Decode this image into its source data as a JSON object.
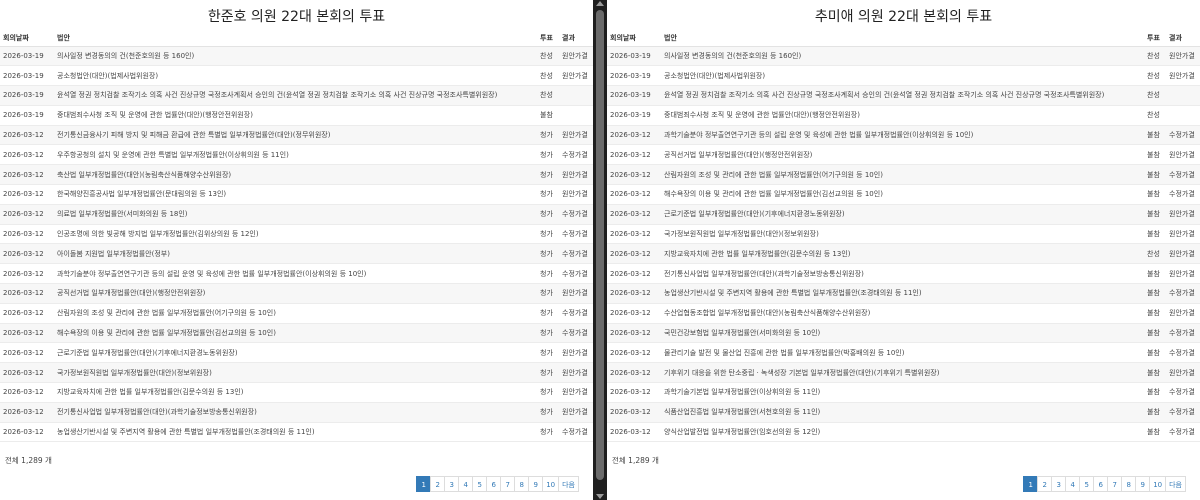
{
  "headers": {
    "date": "회의날짜",
    "bill": "법안",
    "vote": "투표",
    "result": "결과"
  },
  "left": {
    "title": "한준호 의원 22대 본회의 투표",
    "total": "전체 1,289 개",
    "rows": [
      {
        "date": "2026-03-19",
        "bill": "의사일정 변경동의의 건(천준호의원 등 160인)",
        "vote": "찬성",
        "result": "원안가결"
      },
      {
        "date": "2026-03-19",
        "bill": "공소청법안(대안)(법제사법위원장)",
        "vote": "찬성",
        "result": "원안가결"
      },
      {
        "date": "2026-03-19",
        "bill": "윤석열 정권 정치검찰 조작기소 의혹 사건 진상규명 국정조사계획서 승인의 건(윤석열 정권 정치검찰 조작기소 의혹 사건 진상규명 국정조사특별위원장)",
        "vote": "찬성",
        "result": ""
      },
      {
        "date": "2026-03-19",
        "bill": "중대범죄수사청 조직 및 운영에 관한 법률안(대안)(행정안전위원장)",
        "vote": "불참",
        "result": ""
      },
      {
        "date": "2026-03-12",
        "bill": "전기통신금융사기 피해 방지 및 피해금 환급에 관한 특별법 일부개정법률안(대안)(정무위원장)",
        "vote": "청가",
        "result": "원안가결"
      },
      {
        "date": "2026-03-12",
        "bill": "우주항공청의 설치 및 운영에 관한 특별법 일부개정법률안(이상휘의원 등 11인)",
        "vote": "청가",
        "result": "수정가결"
      },
      {
        "date": "2026-03-12",
        "bill": "축산법 일부개정법률안(대안)(농림축산식품해양수산위원장)",
        "vote": "청가",
        "result": "원안가결"
      },
      {
        "date": "2026-03-12",
        "bill": "한국해양진흥공사법 일부개정법률안(문대림의원 등 13인)",
        "vote": "청가",
        "result": "원안가결"
      },
      {
        "date": "2026-03-12",
        "bill": "의료법 일부개정법률안(서미화의원 등 18인)",
        "vote": "청가",
        "result": "수정가결"
      },
      {
        "date": "2026-03-12",
        "bill": "인공조명에 의한 빛공해 방지법 일부개정법률안(김위상의원 등 12인)",
        "vote": "청가",
        "result": "수정가결"
      },
      {
        "date": "2026-03-12",
        "bill": "아이돌봄 지원법 일부개정법률안(정부)",
        "vote": "청가",
        "result": "수정가결"
      },
      {
        "date": "2026-03-12",
        "bill": "과학기술분야 정부출연연구기관 등의 설립 운영 및 육성에 관한 법률 일부개정법률안(이상휘의원 등 10인)",
        "vote": "청가",
        "result": "수정가결"
      },
      {
        "date": "2026-03-12",
        "bill": "공직선거법 일부개정법률안(대안)(행정안전위원장)",
        "vote": "청가",
        "result": "원안가결"
      },
      {
        "date": "2026-03-12",
        "bill": "산림자원의 조성 및 관리에 관한 법률 일부개정법률안(어기구의원 등 10인)",
        "vote": "청가",
        "result": "수정가결"
      },
      {
        "date": "2026-03-12",
        "bill": "해수욕장의 이용 및 관리에 관한 법률 일부개정법률안(김선교의원 등 10인)",
        "vote": "청가",
        "result": "수정가결"
      },
      {
        "date": "2026-03-12",
        "bill": "근로기준법 일부개정법률안(대안)(기후에너지환경노동위원장)",
        "vote": "청가",
        "result": "원안가결"
      },
      {
        "date": "2026-03-12",
        "bill": "국가정보원직원법 일부개정법률안(대안)(정보위원장)",
        "vote": "청가",
        "result": "원안가결"
      },
      {
        "date": "2026-03-12",
        "bill": "지방교육자치에 관한 법률 일부개정법률안(김문수의원 등 13인)",
        "vote": "청가",
        "result": "원안가결"
      },
      {
        "date": "2026-03-12",
        "bill": "전기통신사업법 일부개정법률안(대안)(과학기술정보방송통신위원장)",
        "vote": "청가",
        "result": "원안가결"
      },
      {
        "date": "2026-03-12",
        "bill": "농업생산기반시설 및 주변지역 활용에 관한 특별법 일부개정법률안(조경태의원 등 11인)",
        "vote": "청가",
        "result": "수정가결"
      }
    ]
  },
  "right": {
    "title": "추미애 의원 22대 본회의 투표",
    "total": "전체 1,289 개",
    "rows": [
      {
        "date": "2026-03-19",
        "bill": "의사일정 변경동의의 건(천준호의원 등 160인)",
        "vote": "찬성",
        "result": "원안가결"
      },
      {
        "date": "2026-03-19",
        "bill": "공소청법안(대안)(법제사법위원장)",
        "vote": "찬성",
        "result": "원안가결"
      },
      {
        "date": "2026-03-19",
        "bill": "윤석열 정권 정치검찰 조작기소 의혹 사건 진상규명 국정조사계획서 승인의 건(윤석열 정권 정치검찰 조작기소 의혹 사건 진상규명 국정조사특별위원장)",
        "vote": "찬성",
        "result": ""
      },
      {
        "date": "2026-03-19",
        "bill": "중대범죄수사청 조직 및 운영에 관한 법률안(대안)(행정안전위원장)",
        "vote": "찬성",
        "result": ""
      },
      {
        "date": "2026-03-12",
        "bill": "과학기술분야 정부출연연구기관 등의 설립 운영 및 육성에 관한 법률 일부개정법률안(이상휘의원 등 10인)",
        "vote": "불참",
        "result": "수정가결"
      },
      {
        "date": "2026-03-12",
        "bill": "공직선거법 일부개정법률안(대안)(행정안전위원장)",
        "vote": "불참",
        "result": "원안가결"
      },
      {
        "date": "2026-03-12",
        "bill": "산림자원의 조성 및 관리에 관한 법률 일부개정법률안(어기구의원 등 10인)",
        "vote": "불참",
        "result": "수정가결"
      },
      {
        "date": "2026-03-12",
        "bill": "해수욕장의 이용 및 관리에 관한 법률 일부개정법률안(김선교의원 등 10인)",
        "vote": "불참",
        "result": "수정가결"
      },
      {
        "date": "2026-03-12",
        "bill": "근로기준법 일부개정법률안(대안)(기후에너지환경노동위원장)",
        "vote": "불참",
        "result": "원안가결"
      },
      {
        "date": "2026-03-12",
        "bill": "국가정보원직원법 일부개정법률안(대안)(정보위원장)",
        "vote": "불참",
        "result": "원안가결"
      },
      {
        "date": "2026-03-12",
        "bill": "지방교육자치에 관한 법률 일부개정법률안(김문수의원 등 13인)",
        "vote": "찬성",
        "result": "원안가결"
      },
      {
        "date": "2026-03-12",
        "bill": "전기통신사업법 일부개정법률안(대안)(과학기술정보방송통신위원장)",
        "vote": "불참",
        "result": "원안가결"
      },
      {
        "date": "2026-03-12",
        "bill": "농업생산기반시설 및 주변지역 활용에 관한 특별법 일부개정법률안(조경태의원 등 11인)",
        "vote": "불참",
        "result": "수정가결"
      },
      {
        "date": "2026-03-12",
        "bill": "수산업협동조합법 일부개정법률안(대안)(농림축산식품해양수산위원장)",
        "vote": "불참",
        "result": "원안가결"
      },
      {
        "date": "2026-03-12",
        "bill": "국민건강보험법 일부개정법률안(서미화의원 등 10인)",
        "vote": "불참",
        "result": "수정가결"
      },
      {
        "date": "2026-03-12",
        "bill": "물관리기술 발전 및 물산업 진흥에 관한 법률 일부개정법률안(박홍배의원 등 10인)",
        "vote": "불참",
        "result": "수정가결"
      },
      {
        "date": "2026-03-12",
        "bill": "기후위기 대응을 위한 탄소중립ㆍ녹색성장 기본법 일부개정법률안(대안)(기후위기 특별위원장)",
        "vote": "불참",
        "result": "원안가결"
      },
      {
        "date": "2026-03-12",
        "bill": "과학기술기본법 일부개정법률안(이상휘의원 등 11인)",
        "vote": "불참",
        "result": "수정가결"
      },
      {
        "date": "2026-03-12",
        "bill": "식품산업진흥법 일부개정법률안(서천호의원 등 11인)",
        "vote": "불참",
        "result": "수정가결"
      },
      {
        "date": "2026-03-12",
        "bill": "양식산업발전법 일부개정법률안(임호선의원 등 12인)",
        "vote": "불참",
        "result": "수정가결"
      }
    ]
  },
  "pagination": {
    "pages": [
      "1",
      "2",
      "3",
      "4",
      "5",
      "6",
      "7",
      "8",
      "9",
      "10"
    ],
    "active": "1",
    "next": "다음"
  }
}
